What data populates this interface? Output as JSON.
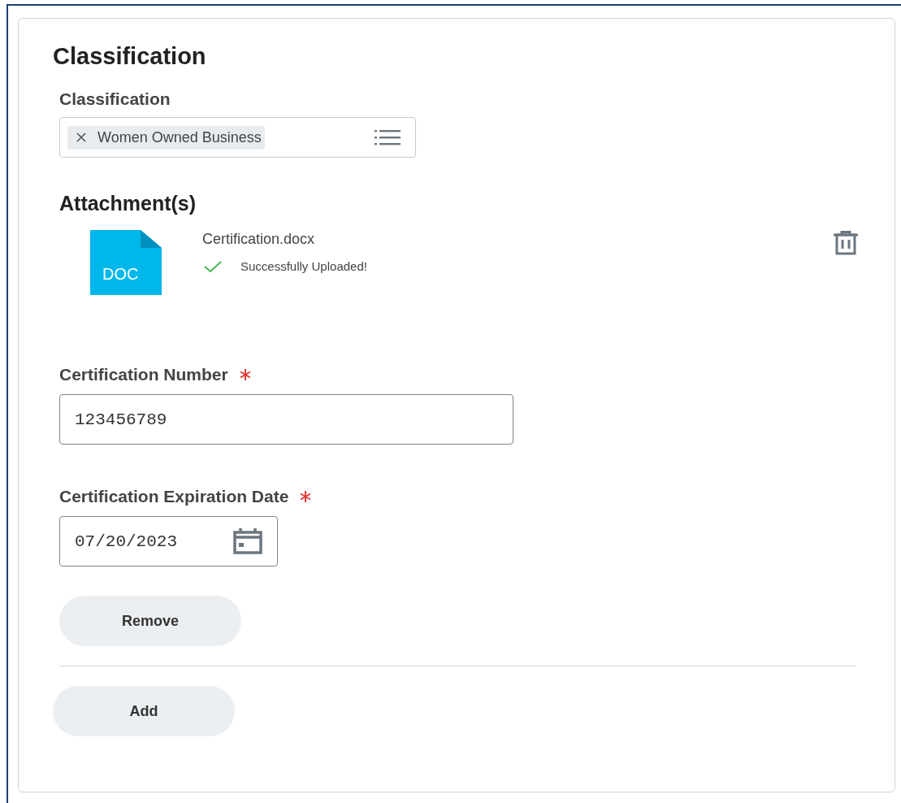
{
  "section": {
    "title": "Classification"
  },
  "classification": {
    "label": "Classification",
    "tags": [
      {
        "text": "Women Owned Business"
      }
    ]
  },
  "attachments": {
    "title": "Attachment(s)",
    "files": [
      {
        "badge": "DOC",
        "name": "Certification.docx",
        "status": "Successfully Uploaded!",
        "uploaded": true
      }
    ]
  },
  "fields": [
    {
      "kind": "text",
      "label": "Certification Number",
      "required": true,
      "value": "123456789"
    },
    {
      "kind": "date",
      "label": "Certification Expiration Date",
      "required": true,
      "value": "07/20/2023"
    }
  ],
  "remove_button": "Remove",
  "add_button": "Add"
}
